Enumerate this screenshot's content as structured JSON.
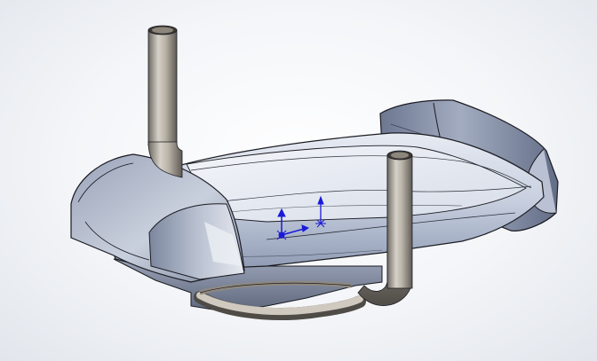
{
  "viewport": {
    "background": [
      "#ffffff",
      "#e2e6ec"
    ],
    "accent_color": "#1a1ad8",
    "body_color": "#9aa6bd",
    "pipe_color": "#b9b2a6",
    "edge_color": "#1b1b22"
  },
  "model": {
    "parts": [
      {
        "name": "shell-body",
        "kind": "shaded-surface"
      },
      {
        "name": "front-hood",
        "kind": "shaded-surface"
      },
      {
        "name": "rear-backrest",
        "kind": "shaded-surface"
      },
      {
        "name": "left-riser-pipe",
        "kind": "tube"
      },
      {
        "name": "right-riser-pipe",
        "kind": "tube"
      },
      {
        "name": "bottom-curved-pipe",
        "kind": "tube"
      }
    ],
    "triad": {
      "icon": "coordinate-triad-icon"
    },
    "origin": {
      "icon": "origin-icon"
    }
  }
}
